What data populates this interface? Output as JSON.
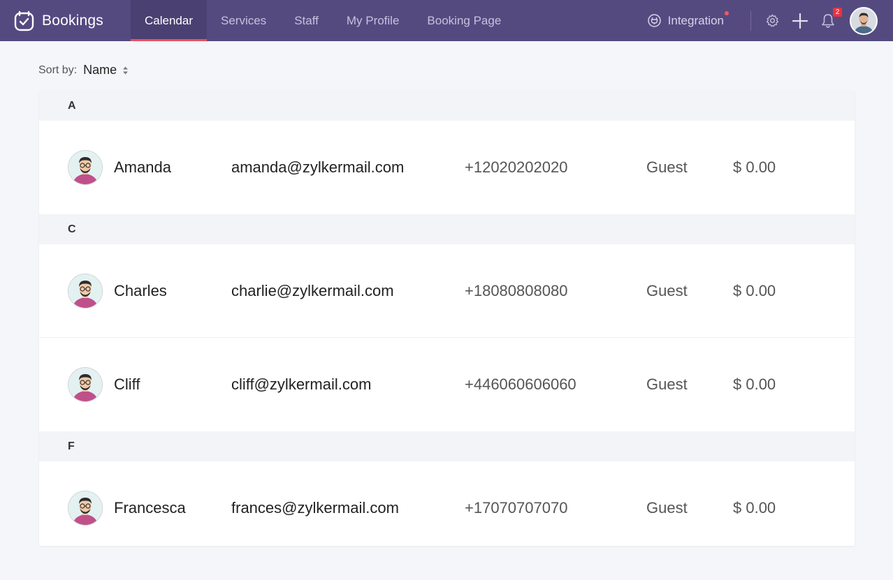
{
  "app": {
    "name": "Bookings"
  },
  "nav": {
    "tabs": [
      {
        "label": "Calendar",
        "active": true
      },
      {
        "label": "Services",
        "active": false
      },
      {
        "label": "Staff",
        "active": false
      },
      {
        "label": "My Profile",
        "active": false
      },
      {
        "label": "Booking Page",
        "active": false
      }
    ]
  },
  "tools": {
    "integration_label": "Integration",
    "notifications_count": "2",
    "icons": [
      "integration-icon",
      "gear-icon",
      "plus-icon",
      "bell-icon"
    ]
  },
  "sort": {
    "label": "Sort by:",
    "value": "Name"
  },
  "groups": [
    {
      "letter": "A",
      "customers": [
        {
          "name": "Amanda",
          "email": "amanda@zylkermail.com",
          "phone": "+12020202020",
          "type": "Guest",
          "amount": "$ 0.00"
        }
      ]
    },
    {
      "letter": "C",
      "customers": [
        {
          "name": "Charles",
          "email": "charlie@zylkermail.com",
          "phone": "+18080808080",
          "type": "Guest",
          "amount": "$ 0.00"
        },
        {
          "name": "Cliff",
          "email": "cliff@zylkermail.com",
          "phone": "+446060606060",
          "type": "Guest",
          "amount": "$ 0.00"
        }
      ]
    },
    {
      "letter": "F",
      "customers": [
        {
          "name": "Francesca",
          "email": "frances@zylkermail.com",
          "phone": "+17070707070",
          "type": "Guest",
          "amount": "$ 0.00"
        }
      ]
    }
  ],
  "colors": {
    "topbar": "#554a80",
    "active_tab": "#4a4072",
    "accent": "#ea4f5b"
  }
}
